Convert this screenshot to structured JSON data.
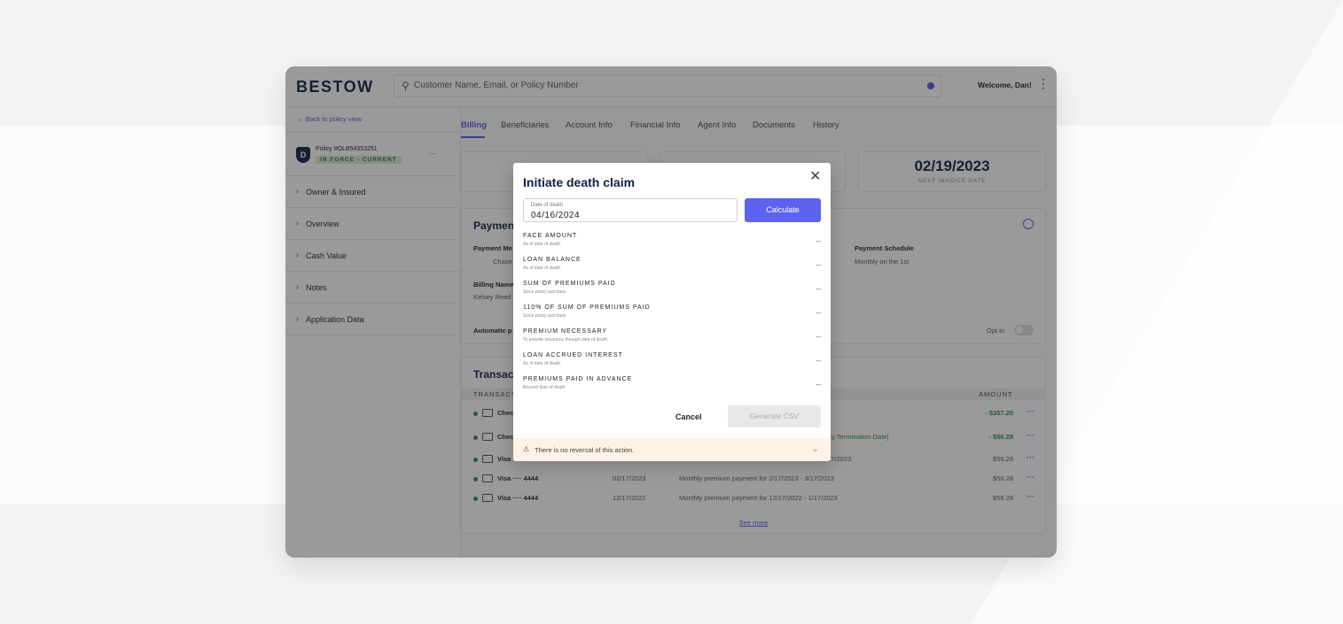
{
  "app": {
    "logo": "BESTOW",
    "search_placeholder": "Customer Name, Email, or Policy Number",
    "welcome": "Welcome, Dan!"
  },
  "sidebar": {
    "back_link": "← Back to policy view",
    "policy_number": "Policy #OLB54353251",
    "policy_status": "IN FORCE - CURRENT",
    "policy_more": "...",
    "items": [
      {
        "label": "Owner & Insured"
      },
      {
        "label": "Overview"
      },
      {
        "label": "Cash Value"
      },
      {
        "label": "Notes"
      },
      {
        "label": "Application Data"
      }
    ]
  },
  "tabs": [
    {
      "label": "Billing"
    },
    {
      "label": "Beneficiaries"
    },
    {
      "label": "Account Info"
    },
    {
      "label": "Financial Info"
    },
    {
      "label": "Agent Info"
    },
    {
      "label": "Documents"
    },
    {
      "label": "History"
    }
  ],
  "stats": {
    "next_invoice_value": "02/19/2023",
    "next_invoice_label": "NEXT INVOICE DATE"
  },
  "payment": {
    "title": "Payment",
    "method_label": "Payment Me",
    "method_value": "Chase",
    "schedule_label": "Payment Schedule",
    "schedule_value": "Monthly on the 1st",
    "billing_name_label": "Billing Name",
    "billing_name_value": "Kelsey Reed",
    "automatic_label": "Automatic p",
    "opt_in_label": "Opt in"
  },
  "transactions": {
    "title": "Transacti",
    "col_transaction": "TRANSACT",
    "col_amount": "AMOUNT",
    "rows": [
      {
        "method": "Chec",
        "date": "",
        "desc": "",
        "amount": "- $357.20"
      },
      {
        "method": "Chec",
        "date": "",
        "desc": "licy Termination Date]",
        "amount": "- $56.28"
      },
      {
        "method": "Visa",
        "date": "",
        "desc": "/17/2023",
        "amount": "$56.28"
      },
      {
        "method": "Visa ···· 4444",
        "date": "02/17/2023",
        "desc": "Monthly premium payment for 2/17/2023 - 3/17/2023",
        "amount": "$56.28"
      },
      {
        "method": "Visa ···· 4444",
        "date": "12/17/2022",
        "desc": "Monthly premium payment for 12/17/2022 - 1/17/2023",
        "amount": "$56.28"
      }
    ],
    "more_label": "···",
    "see_more": "See more"
  },
  "modal": {
    "title": "Initiate death claim",
    "date_label": "Date of death",
    "date_value": "04/16/2024",
    "calculate": "Calculate",
    "rows": [
      {
        "label": "FACE AMOUNT",
        "sub": "As of date of death",
        "value": "--"
      },
      {
        "label": "LOAN BALANCE",
        "sub": "As of date of death",
        "value": "--"
      },
      {
        "label": "SUM OF PREMIUMS PAID",
        "sub": "Since policy purchase",
        "value": "--"
      },
      {
        "label": "110% OF SUM OF PREMIUMS PAID",
        "sub": "Since policy purchase",
        "value": "--"
      },
      {
        "label": "PREMIUM NECESSARY",
        "sub": "To provide insurance through date of death",
        "value": "--"
      },
      {
        "label": "LOAN ACCRUED INTEREST",
        "sub": "As of date of death",
        "value": "--"
      },
      {
        "label": "PREMIUMS PAID IN ADVANCE",
        "sub": "Beyond date of death",
        "value": "--"
      }
    ],
    "cancel": "Cancel",
    "generate": "Generate CSV",
    "warning": "There is no reversal of this action."
  },
  "colors": {
    "accent": "#5b63f0",
    "navy": "#0e1f44",
    "success": "#2d8a4a",
    "warning_bg": "#fdf2e3"
  }
}
